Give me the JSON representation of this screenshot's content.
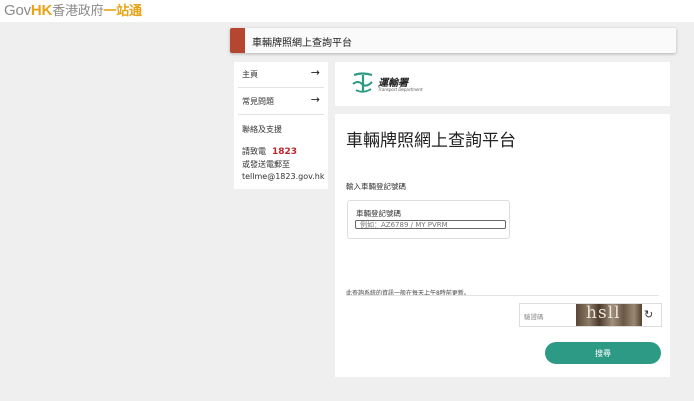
{
  "header": {
    "logo_gov": "Gov",
    "logo_hk": "HK",
    "logo_cn_main": "香港政府",
    "logo_cn_accent": "一站通"
  },
  "titlebar": {
    "title": "車輛牌照網上查詢平台"
  },
  "sidebar": {
    "items": [
      {
        "label": "主頁",
        "arrow": "→"
      },
      {
        "label": "常見問題",
        "arrow": "→"
      }
    ],
    "contact_heading": "聯絡及支援",
    "call_prefix": "請致電",
    "hotline": "1823",
    "email_prefix": "或發送電郵至",
    "email": "tellme@1823.gov.hk"
  },
  "department": {
    "name_cn": "運輸署",
    "name_en": "Transport Department",
    "brand_color": "#2d9a85"
  },
  "form": {
    "title": "車輛牌照網上查詢平台",
    "entry_label": "輸入車輛登記號碼",
    "plate_caption": "車輛登記號碼",
    "plate_placeholder": "例如：AZ6789 / MY PVRM",
    "plate_value": "",
    "update_note": "此查詢系統的資訊一般在每天上午8時前更新。",
    "captcha_placeholder": "驗證碼",
    "captcha_text": "hsll",
    "refresh_icon": "↻",
    "search_label": "搜尋",
    "button_color": "#2d9a85"
  }
}
